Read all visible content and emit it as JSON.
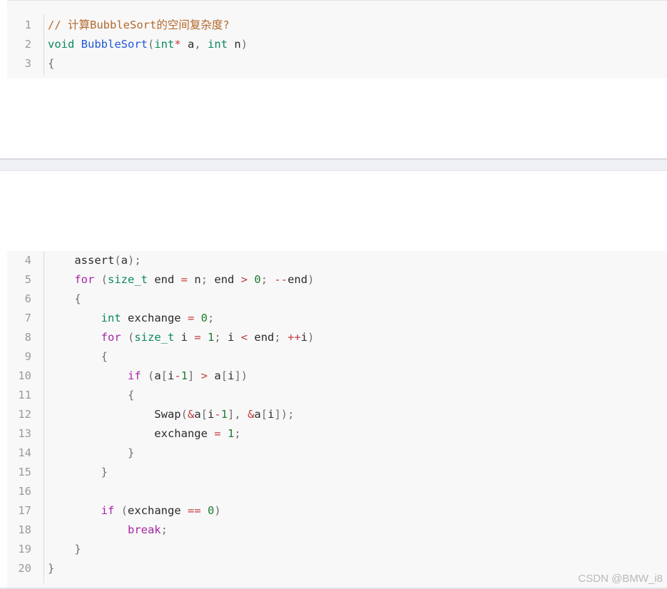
{
  "watermark": "CSDN @BMW_i8",
  "code_lines": [
    {
      "n": "1",
      "tokens": [
        [
          "// 计算BubbleSort的空间复杂度?",
          "comment"
        ]
      ]
    },
    {
      "n": "2",
      "tokens": [
        [
          "void",
          "type"
        ],
        [
          " ",
          "var"
        ],
        [
          "BubbleSort",
          "func"
        ],
        [
          "(",
          "punct"
        ],
        [
          "int",
          "type"
        ],
        [
          "*",
          "op"
        ],
        [
          " a",
          "var"
        ],
        [
          ",",
          "punct"
        ],
        [
          " ",
          "var"
        ],
        [
          "int",
          "type"
        ],
        [
          " n",
          "var"
        ],
        [
          ")",
          "punct"
        ]
      ]
    },
    {
      "n": "3",
      "tokens": [
        [
          "{",
          "punct"
        ]
      ]
    },
    {
      "n": "4",
      "tokens": [
        [
          "    assert",
          "var"
        ],
        [
          "(",
          "punct"
        ],
        [
          "a",
          "var"
        ],
        [
          ");",
          "punct"
        ]
      ]
    },
    {
      "n": "5",
      "tokens": [
        [
          "    ",
          "var"
        ],
        [
          "for",
          "kw"
        ],
        [
          " (",
          "punct"
        ],
        [
          "size_t",
          "type"
        ],
        [
          " end ",
          "var"
        ],
        [
          "=",
          "op"
        ],
        [
          " n",
          "var"
        ],
        [
          ";",
          "punct"
        ],
        [
          " end ",
          "var"
        ],
        [
          ">",
          "op"
        ],
        [
          " ",
          "var"
        ],
        [
          "0",
          "num"
        ],
        [
          ";",
          "punct"
        ],
        [
          " ",
          "var"
        ],
        [
          "--",
          "op"
        ],
        [
          "end",
          "var"
        ],
        [
          ")",
          "punct"
        ]
      ]
    },
    {
      "n": "6",
      "tokens": [
        [
          "    {",
          "punct"
        ]
      ]
    },
    {
      "n": "7",
      "tokens": [
        [
          "        ",
          "var"
        ],
        [
          "int",
          "type"
        ],
        [
          " exchange ",
          "var"
        ],
        [
          "=",
          "op"
        ],
        [
          " ",
          "var"
        ],
        [
          "0",
          "num"
        ],
        [
          ";",
          "punct"
        ]
      ]
    },
    {
      "n": "8",
      "tokens": [
        [
          "        ",
          "var"
        ],
        [
          "for",
          "kw"
        ],
        [
          " (",
          "punct"
        ],
        [
          "size_t",
          "type"
        ],
        [
          " i ",
          "var"
        ],
        [
          "=",
          "op"
        ],
        [
          " ",
          "var"
        ],
        [
          "1",
          "num"
        ],
        [
          ";",
          "punct"
        ],
        [
          " i ",
          "var"
        ],
        [
          "<",
          "op"
        ],
        [
          " end",
          "var"
        ],
        [
          ";",
          "punct"
        ],
        [
          " ",
          "var"
        ],
        [
          "++",
          "op"
        ],
        [
          "i",
          "var"
        ],
        [
          ")",
          "punct"
        ]
      ]
    },
    {
      "n": "9",
      "tokens": [
        [
          "        {",
          "punct"
        ]
      ]
    },
    {
      "n": "10",
      "tokens": [
        [
          "            ",
          "var"
        ],
        [
          "if",
          "kw"
        ],
        [
          " (",
          "punct"
        ],
        [
          "a",
          "var"
        ],
        [
          "[",
          "punct"
        ],
        [
          "i",
          "var"
        ],
        [
          "-",
          "op"
        ],
        [
          "1",
          "num"
        ],
        [
          "]",
          "punct"
        ],
        [
          " ",
          "var"
        ],
        [
          ">",
          "op"
        ],
        [
          " a",
          "var"
        ],
        [
          "[",
          "punct"
        ],
        [
          "i",
          "var"
        ],
        [
          "])",
          "punct"
        ]
      ]
    },
    {
      "n": "11",
      "tokens": [
        [
          "            {",
          "punct"
        ]
      ]
    },
    {
      "n": "12",
      "tokens": [
        [
          "                Swap",
          "var"
        ],
        [
          "(",
          "punct"
        ],
        [
          "&",
          "op"
        ],
        [
          "a",
          "var"
        ],
        [
          "[",
          "punct"
        ],
        [
          "i",
          "var"
        ],
        [
          "-",
          "op"
        ],
        [
          "1",
          "num"
        ],
        [
          "],",
          "punct"
        ],
        [
          " ",
          "var"
        ],
        [
          "&",
          "op"
        ],
        [
          "a",
          "var"
        ],
        [
          "[",
          "punct"
        ],
        [
          "i",
          "var"
        ],
        [
          "]);",
          "punct"
        ]
      ]
    },
    {
      "n": "13",
      "tokens": [
        [
          "                exchange ",
          "var"
        ],
        [
          "=",
          "op"
        ],
        [
          " ",
          "var"
        ],
        [
          "1",
          "num"
        ],
        [
          ";",
          "punct"
        ]
      ]
    },
    {
      "n": "14",
      "tokens": [
        [
          "            }",
          "punct"
        ]
      ]
    },
    {
      "n": "15",
      "tokens": [
        [
          "        }",
          "punct"
        ]
      ]
    },
    {
      "n": "16",
      "tokens": []
    },
    {
      "n": "17",
      "tokens": [
        [
          "        ",
          "var"
        ],
        [
          "if",
          "kw"
        ],
        [
          " (",
          "punct"
        ],
        [
          "exchange ",
          "var"
        ],
        [
          "==",
          "op"
        ],
        [
          " ",
          "var"
        ],
        [
          "0",
          "num"
        ],
        [
          ")",
          "punct"
        ]
      ]
    },
    {
      "n": "18",
      "tokens": [
        [
          "            ",
          "var"
        ],
        [
          "break",
          "kw"
        ],
        [
          ";",
          "punct"
        ]
      ]
    },
    {
      "n": "19",
      "tokens": [
        [
          "    }",
          "punct"
        ]
      ]
    },
    {
      "n": "20",
      "tokens": [
        [
          "}",
          "punct"
        ]
      ]
    }
  ]
}
